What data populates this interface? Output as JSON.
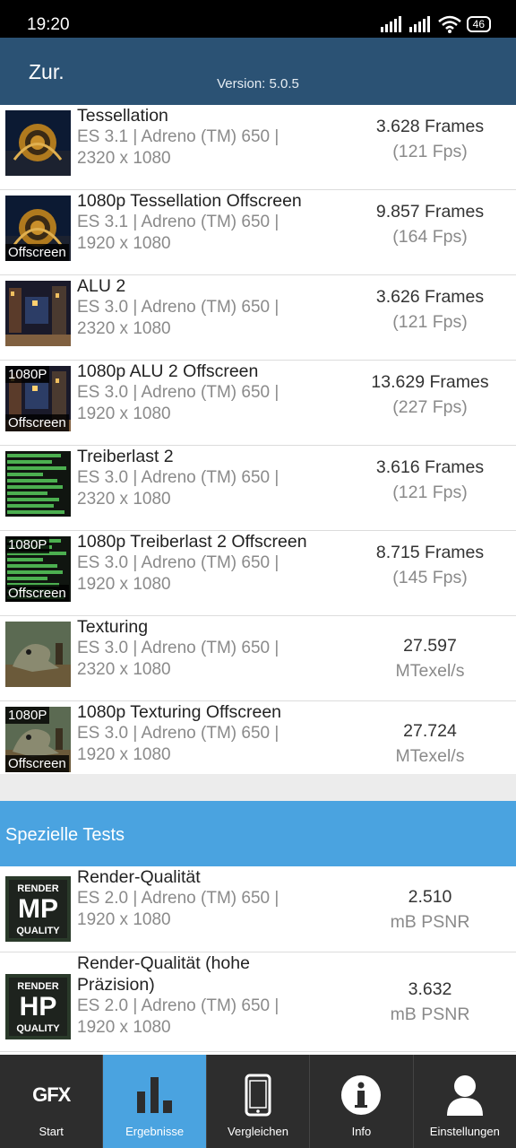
{
  "status": {
    "time": "19:20",
    "battery": "46"
  },
  "header": {
    "back_label": "Zur.",
    "version": "Version: 5.0.5"
  },
  "tests": [
    {
      "title": "Tessellation",
      "api": "ES 3.1 | Adreno (TM) 650 |",
      "resolution": "2320 x 1080",
      "value": "3.628 Frames",
      "unit": "(121 Fps)",
      "thumb": "tessellation-icon",
      "badge_top": "",
      "badge_bottom": ""
    },
    {
      "title": "1080p Tessellation Offscreen",
      "api": "ES 3.1 | Adreno (TM) 650 |",
      "resolution": "1920 x 1080",
      "value": "9.857 Frames",
      "unit": "(164 Fps)",
      "thumb": "tessellation-icon",
      "badge_top": "",
      "badge_bottom": "Offscreen"
    },
    {
      "title": "ALU 2",
      "api": "ES 3.0 | Adreno (TM) 650 |",
      "resolution": "2320 x 1080",
      "value": "3.626 Frames",
      "unit": "(121 Fps)",
      "thumb": "alu-icon",
      "badge_top": "",
      "badge_bottom": ""
    },
    {
      "title": "1080p ALU 2 Offscreen",
      "api": "ES 3.0 | Adreno (TM) 650 |",
      "resolution": "1920 x 1080",
      "value": "13.629 Frames",
      "unit": "(227 Fps)",
      "thumb": "alu-icon",
      "badge_top": "1080P",
      "badge_bottom": "Offscreen"
    },
    {
      "title": "Treiberlast 2",
      "api": "ES 3.0 | Adreno (TM) 650 |",
      "resolution": "2320 x 1080",
      "value": "3.616 Frames",
      "unit": "(121 Fps)",
      "thumb": "driver-icon",
      "badge_top": "",
      "badge_bottom": ""
    },
    {
      "title": "1080p Treiberlast 2 Offscreen",
      "api": "ES 3.0 | Adreno (TM) 650 |",
      "resolution": "1920 x 1080",
      "value": "8.715 Frames",
      "unit": "(145 Fps)",
      "thumb": "driver-icon",
      "badge_top": "1080P",
      "badge_bottom": "Offscreen"
    },
    {
      "title": "Texturing",
      "api": "ES 3.0 | Adreno (TM) 650 |",
      "resolution": "2320 x 1080",
      "value": "27.597",
      "unit": "MTexel/s",
      "thumb": "texturing-icon",
      "badge_top": "",
      "badge_bottom": ""
    },
    {
      "title": "1080p Texturing Offscreen",
      "api": "ES 3.0 | Adreno (TM) 650 |",
      "resolution": "1920 x 1080",
      "value": "27.724",
      "unit": "MTexel/s",
      "thumb": "texturing-icon",
      "badge_top": "1080P",
      "badge_bottom": "Offscreen"
    }
  ],
  "section_title": "Spezielle Tests",
  "special": [
    {
      "title": "Render-Qualität",
      "api": "ES 2.0 | Adreno (TM) 650 |",
      "resolution": "1920 x 1080",
      "value": "2.510",
      "unit": "mB PSNR",
      "badge_top": "RENDER",
      "badge_mid": "MP",
      "badge_bottom": "QUALITY"
    },
    {
      "title": "Render-Qualität (hohe",
      "title2": "Präzision)",
      "api": "ES 2.0 | Adreno (TM) 650 |",
      "resolution": "1920 x 1080",
      "value": "3.632",
      "unit": "mB PSNR",
      "badge_top": "RENDER",
      "badge_mid": "HP",
      "badge_bottom": "QUALITY"
    }
  ],
  "tabs": [
    {
      "label": "Start",
      "icon": "gfx-logo-icon",
      "text": "GFX"
    },
    {
      "label": "Ergebnisse",
      "icon": "bar-chart-icon"
    },
    {
      "label": "Vergleichen",
      "icon": "phone-icon"
    },
    {
      "label": "Info",
      "icon": "info-icon"
    },
    {
      "label": "Einstellungen",
      "icon": "user-icon"
    }
  ],
  "colors": {
    "appbar": "#2b5274",
    "accent": "#4aa3e0",
    "tabbar": "#2d2d2d"
  }
}
